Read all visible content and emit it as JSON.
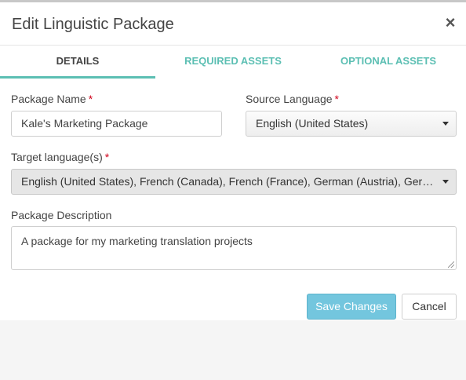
{
  "dialog": {
    "title": "Edit Linguistic Package",
    "close_label": "×"
  },
  "tabs": [
    {
      "label": "DETAILS",
      "active": true
    },
    {
      "label": "REQUIRED ASSETS",
      "active": false
    },
    {
      "label": "OPTIONAL ASSETS",
      "active": false
    }
  ],
  "form": {
    "package_name": {
      "label": "Package Name",
      "required_mark": "*",
      "value": "Kale's Marketing Package"
    },
    "source_language": {
      "label": "Source Language",
      "required_mark": "*",
      "value": "English (United States)"
    },
    "target_languages": {
      "label": "Target language(s)",
      "required_mark": "*",
      "value": "English (United States), French (Canada), French (France), German (Austria), German..."
    },
    "description": {
      "label": "Package Description",
      "value": "A package for my marketing translation projects"
    }
  },
  "buttons": {
    "save": "Save Changes",
    "cancel": "Cancel"
  },
  "colors": {
    "accent": "#5cbfb3",
    "primary_button": "#73c6de",
    "required": "#d0021b"
  }
}
